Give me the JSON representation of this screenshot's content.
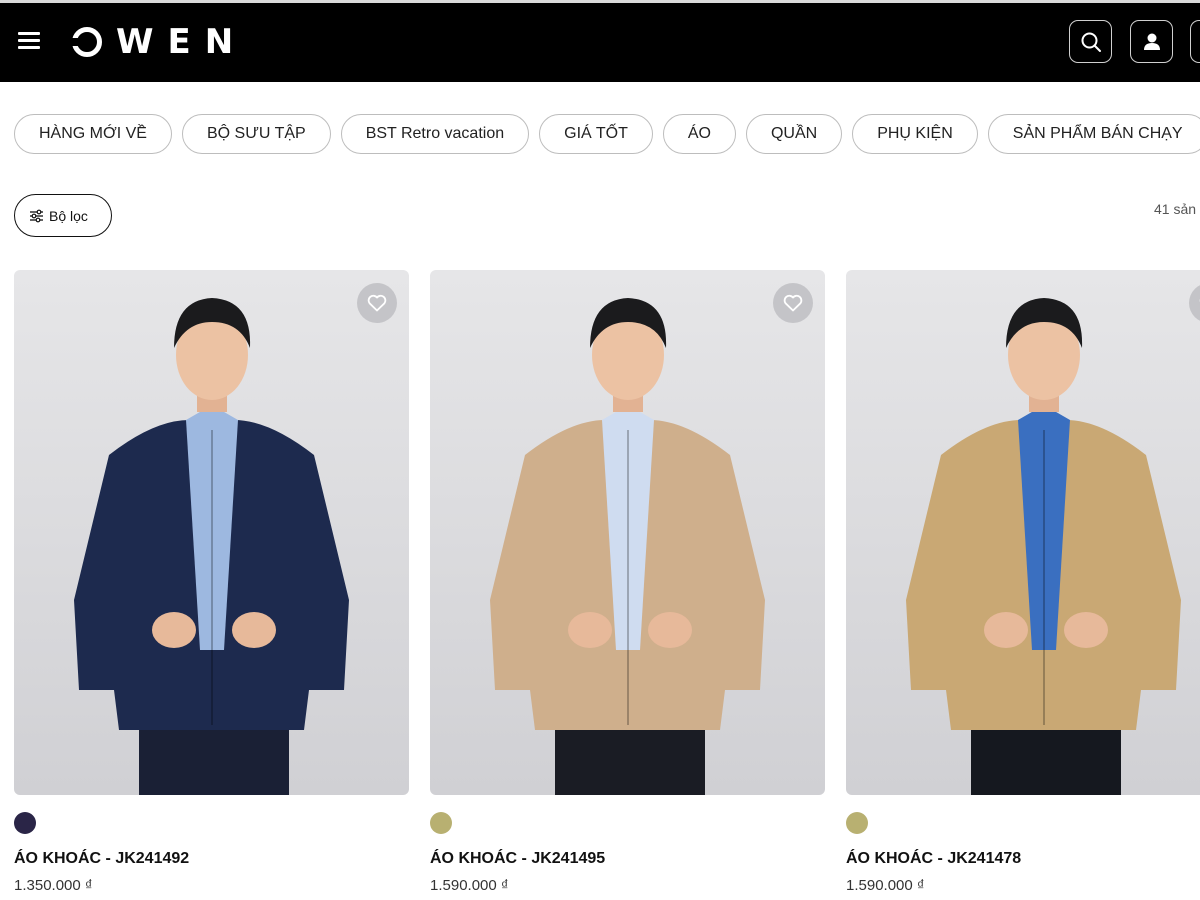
{
  "header": {
    "logo": "OWEN",
    "menu_icon": "hamburger-menu-icon",
    "search_icon": "search-icon",
    "account_icon": "user-icon",
    "cart_icon": "cart-icon",
    "background": "#000000"
  },
  "categories": [
    "HÀNG MỚI VỀ",
    "BỘ SƯU TẬP",
    "BST Retro vacation",
    "GIÁ TỐT",
    "ÁO",
    "QUẦN",
    "PHỤ KIỆN",
    "SẢN PHẨM BÁN CHẠY"
  ],
  "filter": {
    "label": "Bộ lọc",
    "icon": "sliders-icon",
    "count_text": "41 sản"
  },
  "products": [
    {
      "name": "ÁO KHOÁC - JK241492",
      "price": "1.350.000 ₫",
      "swatch_color": "#2a2547",
      "jacket_color": "#1d2a4e",
      "shirt_color": "#9db8e0",
      "pants_color": "#1a2035"
    },
    {
      "name": "ÁO KHOÁC - JK241495",
      "price": "1.590.000 ₫",
      "swatch_color": "#b8b071",
      "jacket_color": "#cfaf8c",
      "shirt_color": "#cfdcf0",
      "pants_color": "#1a1c24"
    },
    {
      "name": "ÁO KHOÁC - JK241478",
      "price": "1.590.000 ₫",
      "swatch_color": "#b8b071",
      "jacket_color": "#c9a874",
      "shirt_color": "#3a6fc0",
      "pants_color": "#15181f"
    }
  ],
  "wishlist_icon": "heart-icon"
}
